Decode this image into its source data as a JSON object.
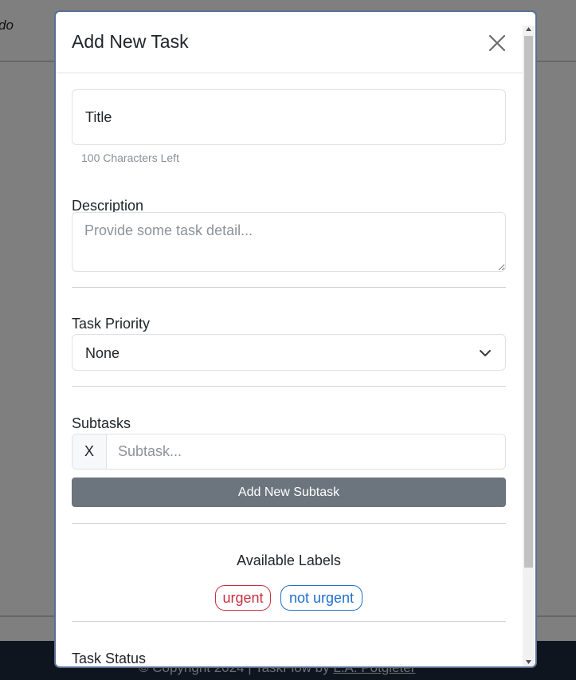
{
  "background": {
    "brand": "do",
    "footer": {
      "copyright": "© Copyright 2024 | TaskFlow by ",
      "author": "L.A. Potgieter"
    }
  },
  "modal": {
    "title": "Add New Task",
    "close_icon": "close-icon",
    "title_field": {
      "placeholder": "Title",
      "value": ""
    },
    "title_chars_left": "100 Characters Left",
    "description": {
      "label": "Description",
      "placeholder": "Provide some task detail..."
    },
    "priority": {
      "label": "Task Priority",
      "selected": "None",
      "icon": "chevron-down-icon"
    },
    "subtasks": {
      "label": "Subtasks",
      "remove_label": "X",
      "placeholder": "Subtask...",
      "add_button": "Add New Subtask"
    },
    "labels": {
      "heading": "Available Labels",
      "items": [
        {
          "text": "urgent",
          "color": "#c5313e"
        },
        {
          "text": "not urgent",
          "color": "#1e6fd1"
        }
      ]
    },
    "status": {
      "label": "Task Status"
    }
  },
  "colors": {
    "backdrop": "rgba(0,0,0,0.5)",
    "button_secondary": "#6c757d",
    "modal_border": "#5a6f96",
    "footer_bg": "#1f2a3c"
  }
}
